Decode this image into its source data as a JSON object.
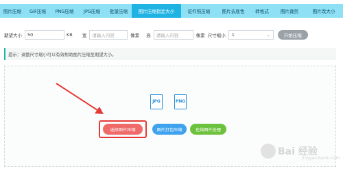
{
  "nav": {
    "tabs": [
      {
        "label": "图片压缩",
        "active": false
      },
      {
        "label": "GIF压缩",
        "active": false
      },
      {
        "label": "PNG压缩",
        "active": false
      },
      {
        "label": "JPG压缩",
        "active": false
      },
      {
        "label": "批量压缩",
        "active": false
      },
      {
        "label": "图片压缩指定大小",
        "active": true
      },
      {
        "label": "证件照压缩",
        "active": false
      },
      {
        "label": "图片去底色",
        "active": false
      },
      {
        "label": "转格式",
        "active": false
      },
      {
        "label": "图片裁剪",
        "active": false
      },
      {
        "label": "图片改大小",
        "active": false
      }
    ]
  },
  "toolbar": {
    "size_label": "期望大小",
    "size_value": "50",
    "size_unit": "KB",
    "width_label": "宽",
    "width_placeholder": "请输入内容",
    "width_unit": "像素",
    "height_label": "高",
    "height_placeholder": "请输入内容",
    "height_unit": "像素",
    "scale_label": "尺寸缩小",
    "scale_value": "1",
    "start_label": "开始压缩"
  },
  "tip": {
    "text": "提示：调整尺寸缩小可以有效帮助图片压缩至期望大小。"
  },
  "upload": {
    "file_types": [
      "JPG",
      "PNG"
    ],
    "select_label": "选择图片压缩",
    "pack_label": "图片打包压缩",
    "online_label": "在线图片处理"
  },
  "watermark": {
    "text": "Bai 经验",
    "sub": "jingyan.baidu.com"
  },
  "colors": {
    "nav_bg": "#8ee0f5",
    "nav_active": "#1fb3e3",
    "select_btn": "#f06a6a",
    "pack_btn": "#3ea2ee",
    "online_btn": "#6cc23c",
    "annotation": "#e53935"
  }
}
